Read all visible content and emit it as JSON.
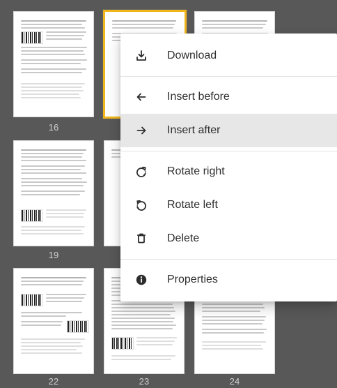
{
  "thumbnails": [
    {
      "page": "16"
    },
    {
      "page": "19"
    },
    {
      "page": "22"
    },
    {
      "page": "23"
    },
    {
      "page": "24"
    }
  ],
  "menu": {
    "download": "Download",
    "insert_before": "Insert before",
    "insert_after": "Insert after",
    "rotate_right": "Rotate right",
    "rotate_left": "Rotate left",
    "delete": "Delete",
    "properties": "Properties"
  },
  "icons": {
    "download": "download-icon",
    "insert_before": "arrow-left-icon",
    "insert_after": "arrow-right-icon",
    "rotate_right": "rotate-right-icon",
    "rotate_left": "rotate-left-icon",
    "delete": "trash-icon",
    "properties": "info-icon"
  },
  "colors": {
    "background": "#585858",
    "selected_outline": "#f0b51a",
    "menu_hover": "#e7e7e7"
  }
}
